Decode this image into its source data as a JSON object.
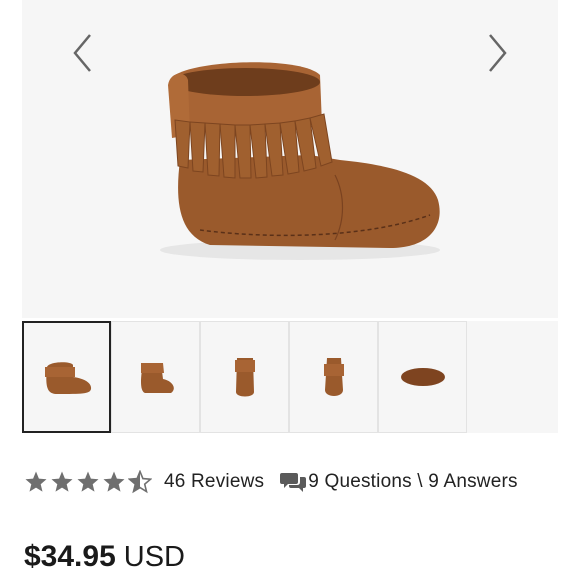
{
  "gallery": {
    "prev_icon": "chevron-left-icon",
    "next_icon": "chevron-right-icon",
    "thumbnail_count": 5,
    "active_index": 0,
    "product_color": "#9a5a2c"
  },
  "rating": {
    "value": 4.5,
    "max": 5,
    "reviews_label": "46 Reviews",
    "qa_icon": "chat-bubbles-icon",
    "qa_label": "9 Questions \\ 9 Answers"
  },
  "price": {
    "amount": "$34.95",
    "currency": "USD"
  }
}
